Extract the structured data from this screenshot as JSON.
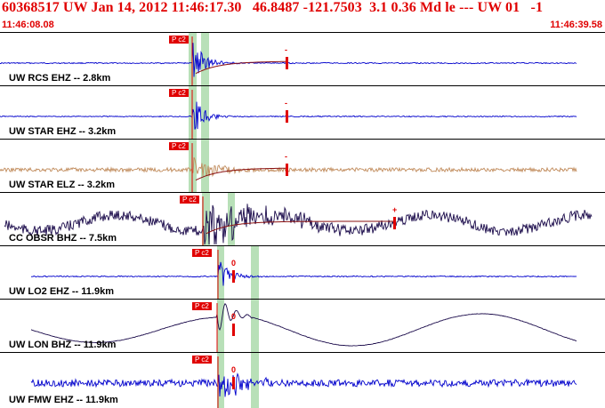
{
  "header": {
    "title": "60368517 UW Jan 14, 2012 11:46:17.30   46.8487 -121.7503  3.1 0.36 Md le --- UW 01   -1",
    "start_time": "11:46:08.08",
    "end_time": "11:46:39.58"
  },
  "colors": {
    "pick": "#e00000",
    "blue_trace": "#0000cc",
    "tan_trace": "#c08a5a",
    "dark_trace": "#1a0a4a",
    "coda_fit": "#8a1010",
    "window_shade": "#b8e0b8"
  },
  "pick_label": "P c2",
  "traces": [
    {
      "label": "UW RCS EHZ -- 2.8km",
      "color_key": "blue_trace",
      "pick_marker": "-"
    },
    {
      "label": "UW STAR EHZ -- 3.2km",
      "color_key": "blue_trace",
      "pick_marker": "-"
    },
    {
      "label": "UW STAR ELZ -- 3.2km",
      "color_key": "tan_trace",
      "pick_marker": "-"
    },
    {
      "label": "CC OBSR BHZ -- 7.5km",
      "color_key": "dark_trace",
      "pick_marker": "+"
    },
    {
      "label": "UW LO2 EHZ -- 11.9km",
      "color_key": "blue_trace",
      "pick_marker": "0"
    },
    {
      "label": "UW LON BHZ -- 11.9km",
      "color_key": "dark_trace",
      "pick_marker": "0"
    },
    {
      "label": "UW FMW EHZ -- 11.9km",
      "color_key": "blue_trace",
      "pick_marker": "0"
    }
  ]
}
